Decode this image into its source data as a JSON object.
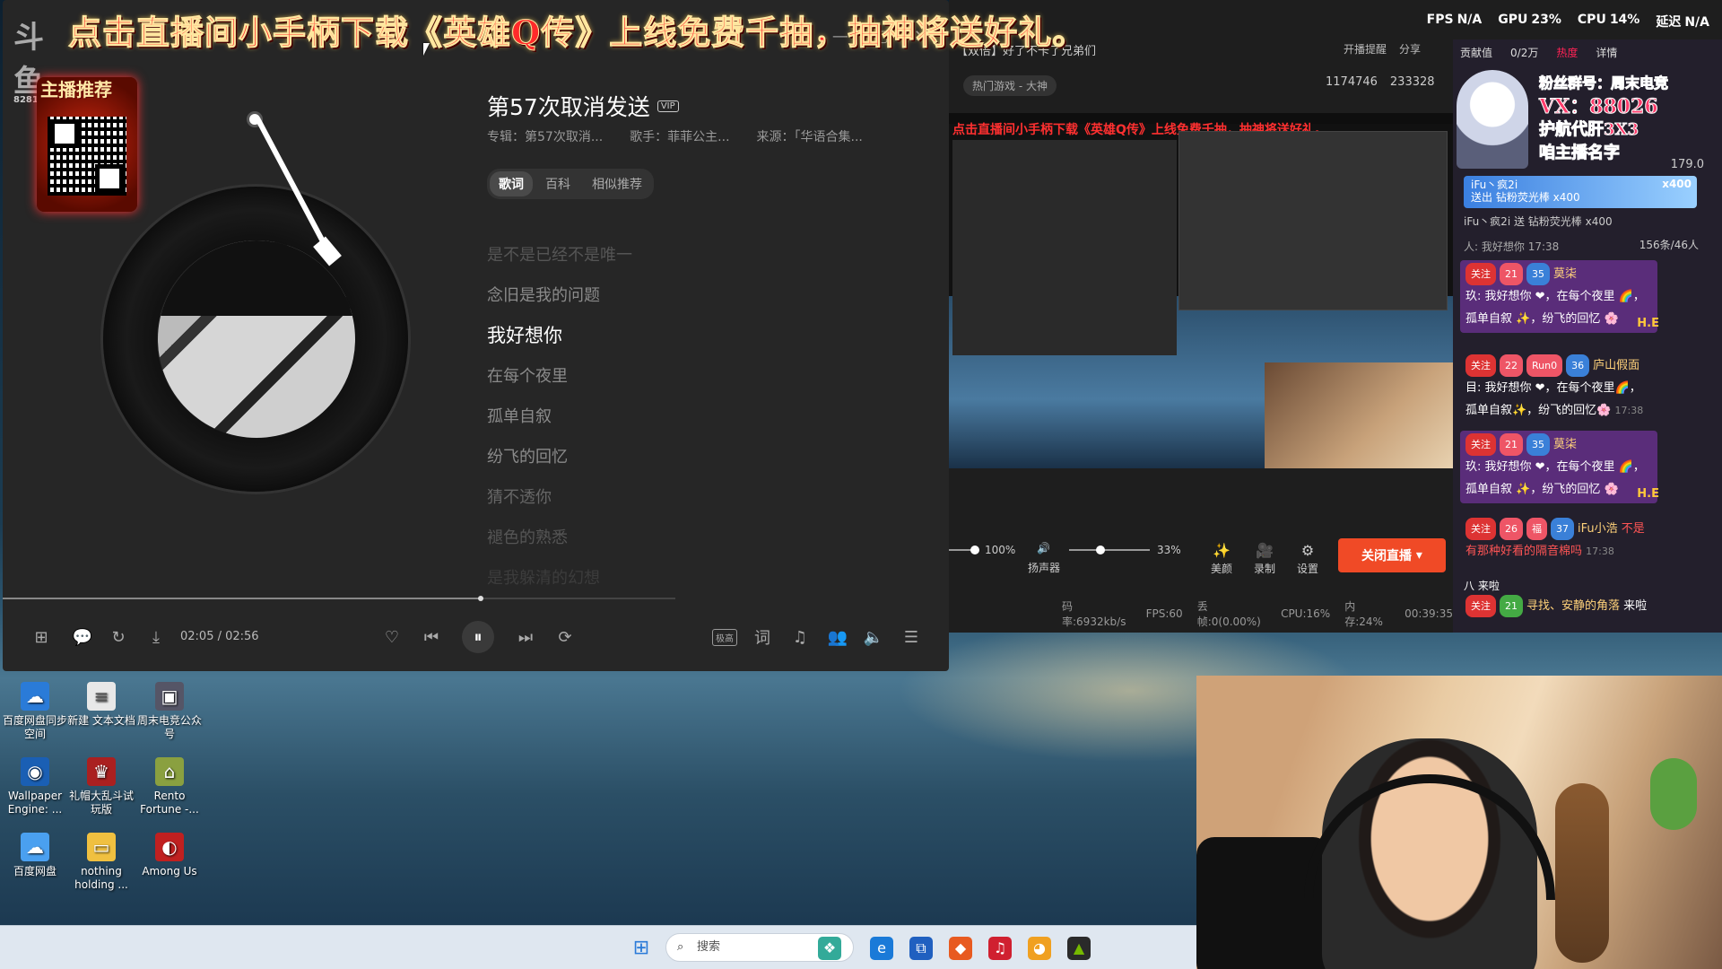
{
  "overlay": {
    "banner": "点击直播间小手柄下载《英雄Q传》上线免费千抽，抽神将送好礼。",
    "stats": {
      "fps_label": "FPS",
      "fps_value": "N/A",
      "gpu_label": "GPU",
      "gpu_value": "23%",
      "cpu_label": "CPU",
      "cpu_value": "14%",
      "latency_label": "延迟",
      "latency_value": "N/A"
    },
    "logo_text": "斗鱼",
    "logo_sub": "8281",
    "promo_title": "主播推荐"
  },
  "player": {
    "song_title": "第57次取消发送",
    "vip_badge": "VIP",
    "album": "专辑：第57次取消...",
    "artist": "歌手：菲菲公主...",
    "source": "来源：「华语合集...",
    "tabs": [
      "歌词",
      "百科",
      "相似推荐"
    ],
    "lyrics": [
      "是不是已经不是唯一",
      "念旧是我的问题",
      "我好想你",
      "在每个夜里",
      "孤单自叙",
      "纷飞的回忆",
      "猜不透你",
      "褪色的熟悉",
      "是我躲清的幻想"
    ],
    "time": "02:05 / 02:56",
    "progress": 0.71,
    "quality_label": "极高",
    "lyric_btn": "词",
    "accent": "#ffffff"
  },
  "stream": {
    "room_title": "【双倍】好了不卡了兄弟们",
    "open_remind": "开播提醒",
    "share": "分享",
    "game_tag": "热门游戏 - 大神",
    "hot_count": "1174746",
    "fans_count": "233328",
    "preview_banner": "点击直播间小手柄下载《英雄Q传》上线免费千抽，抽神将送好礼。",
    "mic_volume": "100%",
    "speaker_label": "扬声器",
    "speaker_volume": "33%",
    "tools": [
      "美颜",
      "录制",
      "设置"
    ],
    "stop_label": "关闭直播",
    "status": {
      "bitrate": "码率:6932kb/s",
      "fps": "FPS:60",
      "drop": "丢帧:0(0.00%)",
      "cpu": "CPU:16%",
      "mem": "内存:24%",
      "duration": "00:39:35"
    },
    "stop_color": "#f04a26"
  },
  "chat": {
    "header": [
      "贡献值",
      "0/2万",
      "热度",
      "详情"
    ],
    "fan_text": [
      "粉丝群号：周末电竞",
      "VX：88026",
      "护航代肝3X3",
      "咱主播名字"
    ],
    "gift_line1": "iFu丶疯2i",
    "gift_line2": "送出 钻粉荧光棒 x400",
    "gift_count": "x400",
    "gift_meta": "iFu丶疯2i 送 钻粉荧光棒 x400",
    "top_value": "179.0",
    "viewer_count": "156条/46人",
    "first_line": "人: 我好想你",
    "first_time": "17:38",
    "follow_tag": "关注",
    "messages": [
      {
        "level": "21",
        "fan": "35",
        "name": "莫柒",
        "text": "玖: 我好想你 ❤，在每个夜里 🌈，孤单自叙 ✨，纷飞的回忆 🌸"
      },
      {
        "level": "22",
        "badge": "Run0",
        "fan": "36",
        "name": "庐山假面",
        "text": "目: 我好想你 ❤，在每个夜里🌈，孤单自叙✨，纷飞的回忆🌸",
        "time": "17:38"
      },
      {
        "level": "21",
        "fan": "35",
        "name": "莫柒",
        "text": "玖: 我好想你 ❤，在每个夜里 🌈，孤单自叙 ✨，纷飞的回忆 🌸"
      },
      {
        "level": "26",
        "badge": "福",
        "fan": "37",
        "name": "iFu小浩",
        "text": "不是有那种好看的隔音棉吗",
        "time": "17:38"
      }
    ],
    "last_line": "八 来啦",
    "last_msg": {
      "level": "21",
      "name": "寻找、安静的角落",
      "text": "来啦"
    },
    "he_mark": "H.E"
  },
  "desktop_icons": [
    {
      "label": "百度网盘同步空间",
      "icon": "baidu-sync-icon",
      "color": "#2a7bd8"
    },
    {
      "label": "新建 文本文档",
      "icon": "text-doc-icon",
      "color": "#e8e8e8"
    },
    {
      "label": "周末电竞公众号",
      "icon": "wechat-image-icon",
      "color": "#556"
    },
    {
      "label": "Wallpaper Engine: ...",
      "icon": "wallpaper-engine-icon",
      "color": "#1a5fb4"
    },
    {
      "label": "礼帽大乱斗试玩版",
      "icon": "hat-game-icon",
      "color": "#aa2020"
    },
    {
      "label": "Rento Fortune -...",
      "icon": "rento-icon",
      "color": "#8aa040"
    },
    {
      "label": "百度网盘",
      "icon": "baidu-netdisk-icon",
      "color": "#4aa0f0"
    },
    {
      "label": "nothing holding ...",
      "icon": "folder-icon",
      "color": "#f0c040"
    },
    {
      "label": "Among Us",
      "icon": "among-us-icon",
      "color": "#c02020"
    }
  ],
  "taskbar": {
    "search_placeholder": "搜索",
    "apps": [
      "start-icon",
      "search-icon",
      "widgets-icon",
      "edge-icon",
      "vscode-icon",
      "app-icon",
      "netease-music-icon",
      "douyu-icon",
      "nvidia-icon"
    ]
  }
}
